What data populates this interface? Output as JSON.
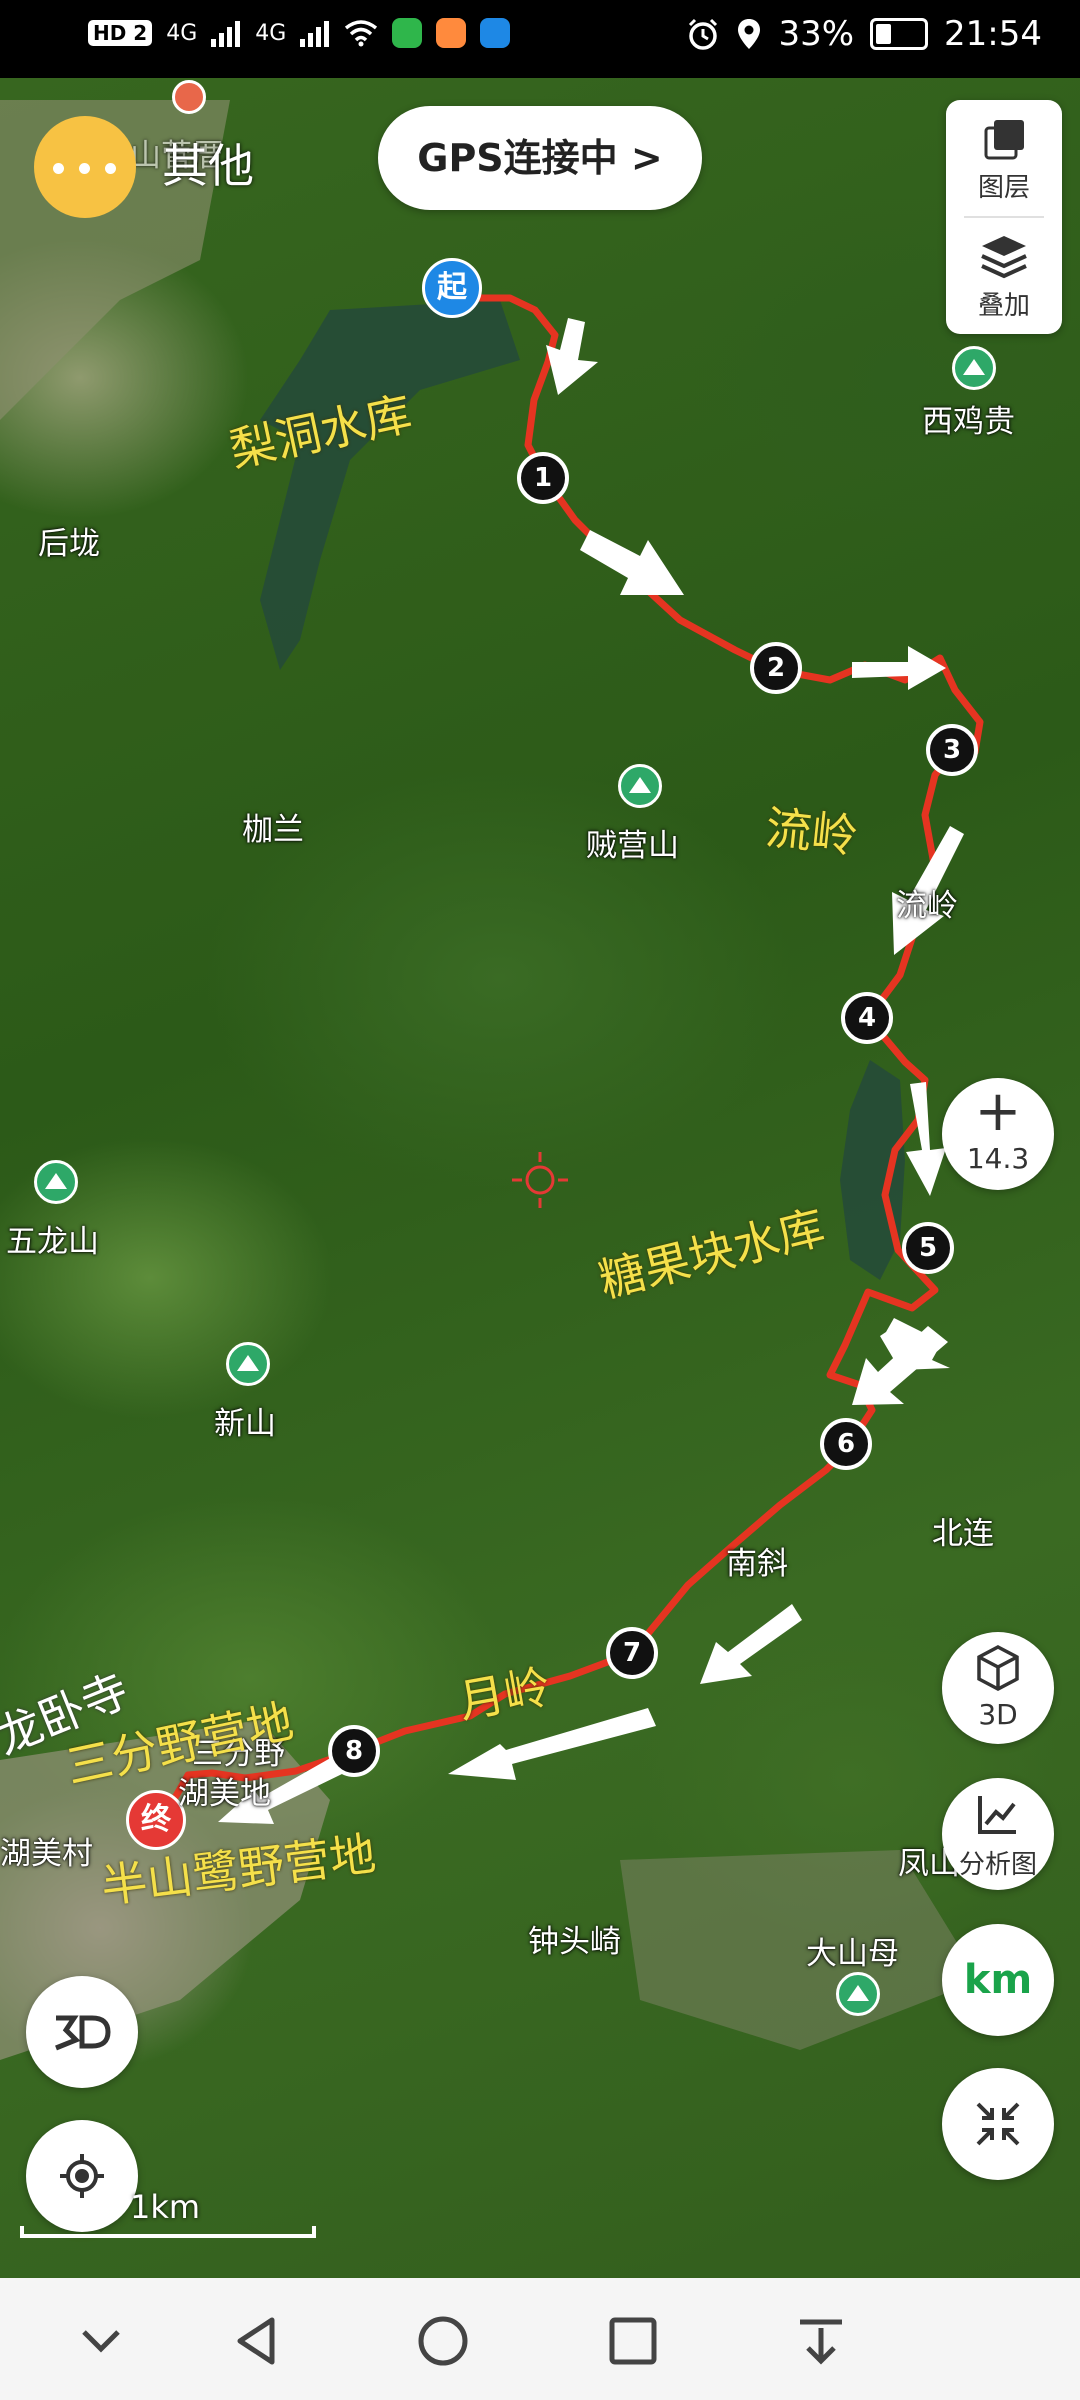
{
  "status_bar": {
    "network_badge": "HD 2",
    "signal_1": "4G",
    "signal_2": "4G",
    "battery_percent": 33,
    "battery_text": "33%",
    "time": "21:54"
  },
  "toolbar": {
    "more_label": "其他",
    "gps_status": "GPS连接中 >",
    "layers_label": "图层",
    "overlay_label": "叠加"
  },
  "controls": {
    "zoom_plus": "+",
    "zoom_level": "14.3",
    "btn_3d": "3D",
    "analysis_label": "分析图",
    "unit_label": "km"
  },
  "scale": {
    "label": "1km"
  },
  "places": {
    "p_shanpu": "山菅厝",
    "xijigui": "西鸡贵",
    "houlong": "后垅",
    "jialan": "枷兰",
    "zeiyingshan": "贼营山",
    "liuling_place": "流岭",
    "wulongshan": "五龙山",
    "xinshan": "新山",
    "beilian": "北连",
    "nanxie": "南斜",
    "fengshan": "凤山",
    "zhongtouqi": "钟头崎",
    "dashanmu": "大山母",
    "humeicun": "湖美村",
    "sanfenye": "三分野",
    "humeibi": "湖美地"
  },
  "annotations": {
    "lidong": "梨洞水库",
    "liuling": "流岭",
    "tangguokuai": "糖果块水库",
    "yueling": "月岭",
    "longwosi": "龙卧寺",
    "sanfen_camp": "三分野营地",
    "banshan_camp": "半山鹭野营地"
  },
  "route": {
    "start_label": "起",
    "end_label": "终",
    "waypoints": [
      "1",
      "2",
      "3",
      "4",
      "5",
      "6",
      "7",
      "8"
    ]
  },
  "colors": {
    "route": "#e53421",
    "start_pin": "#1e88e5",
    "end_pin": "#e53935",
    "more_button": "#f7c243",
    "unit_text": "#1aa34a",
    "annotation_text": "#f5e04a"
  }
}
